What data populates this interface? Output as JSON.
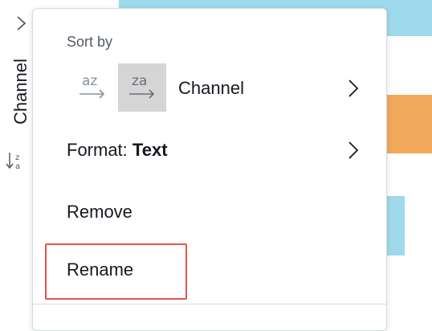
{
  "axis": {
    "label": "Channel",
    "expand_icon": "chevron-right-icon",
    "sort_icon": "sort-za-icon"
  },
  "menu": {
    "sort_header": "Sort by",
    "sort_asc_icon": "sort-az-icon",
    "sort_desc_icon": "sort-za-icon",
    "sort_desc_selected": true,
    "sort_field": "Channel",
    "format_prefix": "Format:",
    "format_value": "Text",
    "remove_label": "Remove",
    "rename_label": "Rename"
  },
  "colors": {
    "bar_blue": "#9fd9ec",
    "bar_orange": "#f2a95c",
    "highlight": "#e8524a",
    "selected_bg": "#d5d5d5"
  }
}
